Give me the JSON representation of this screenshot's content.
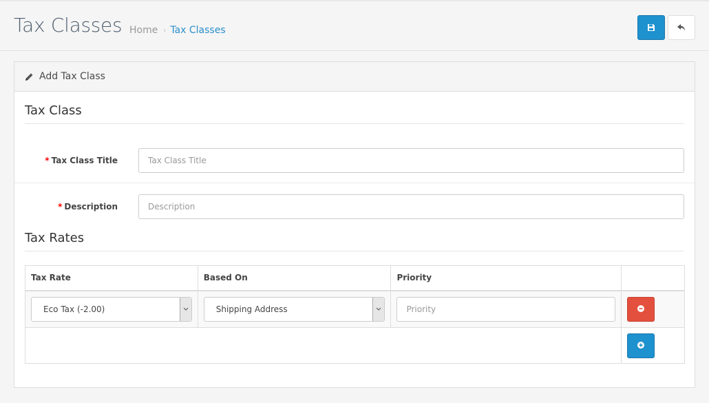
{
  "header": {
    "title": "Tax Classes",
    "breadcrumb": [
      {
        "label": "Home"
      },
      {
        "label": "Tax Classes"
      }
    ],
    "save_icon": "floppy-disk-icon",
    "back_icon": "reply-arrow-icon"
  },
  "panel": {
    "heading_icon": "pencil-icon",
    "heading": "Add Tax Class",
    "section_tax_class": "Tax Class",
    "fields": {
      "title": {
        "label": "Tax Class Title",
        "required": "*",
        "value": "",
        "placeholder": "Tax Class Title"
      },
      "description": {
        "label": "Description",
        "required": "*",
        "value": "",
        "placeholder": "Description"
      }
    },
    "section_tax_rates": "Tax Rates",
    "table": {
      "columns": [
        "Tax Rate",
        "Based On",
        "Priority",
        ""
      ],
      "rows": [
        {
          "tax_rate": "Eco Tax (-2.00)",
          "based_on": "Shipping Address",
          "priority_value": "",
          "priority_placeholder": "Priority",
          "remove_icon": "minus-circle-icon"
        }
      ],
      "add_icon": "plus-circle-icon"
    }
  },
  "colors": {
    "primary": "#1e91cf",
    "danger": "#e3503e",
    "required": "#ff0000",
    "link": "#2b8fcb"
  }
}
